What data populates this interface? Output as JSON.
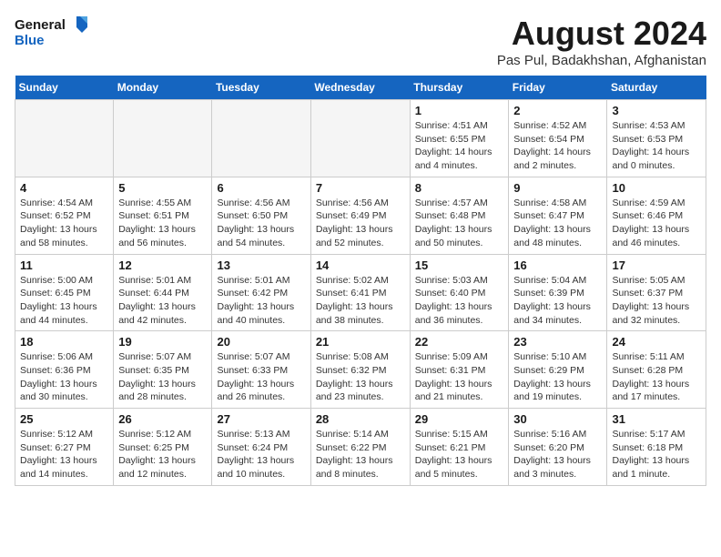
{
  "header": {
    "logo_line1": "General",
    "logo_line2": "Blue",
    "month_year": "August 2024",
    "location": "Pas Pul, Badakhshan, Afghanistan"
  },
  "days_of_week": [
    "Sunday",
    "Monday",
    "Tuesday",
    "Wednesday",
    "Thursday",
    "Friday",
    "Saturday"
  ],
  "weeks": [
    [
      {
        "day": "",
        "info": ""
      },
      {
        "day": "",
        "info": ""
      },
      {
        "day": "",
        "info": ""
      },
      {
        "day": "",
        "info": ""
      },
      {
        "day": "1",
        "info": "Sunrise: 4:51 AM\nSunset: 6:55 PM\nDaylight: 14 hours\nand 4 minutes."
      },
      {
        "day": "2",
        "info": "Sunrise: 4:52 AM\nSunset: 6:54 PM\nDaylight: 14 hours\nand 2 minutes."
      },
      {
        "day": "3",
        "info": "Sunrise: 4:53 AM\nSunset: 6:53 PM\nDaylight: 14 hours\nand 0 minutes."
      }
    ],
    [
      {
        "day": "4",
        "info": "Sunrise: 4:54 AM\nSunset: 6:52 PM\nDaylight: 13 hours\nand 58 minutes."
      },
      {
        "day": "5",
        "info": "Sunrise: 4:55 AM\nSunset: 6:51 PM\nDaylight: 13 hours\nand 56 minutes."
      },
      {
        "day": "6",
        "info": "Sunrise: 4:56 AM\nSunset: 6:50 PM\nDaylight: 13 hours\nand 54 minutes."
      },
      {
        "day": "7",
        "info": "Sunrise: 4:56 AM\nSunset: 6:49 PM\nDaylight: 13 hours\nand 52 minutes."
      },
      {
        "day": "8",
        "info": "Sunrise: 4:57 AM\nSunset: 6:48 PM\nDaylight: 13 hours\nand 50 minutes."
      },
      {
        "day": "9",
        "info": "Sunrise: 4:58 AM\nSunset: 6:47 PM\nDaylight: 13 hours\nand 48 minutes."
      },
      {
        "day": "10",
        "info": "Sunrise: 4:59 AM\nSunset: 6:46 PM\nDaylight: 13 hours\nand 46 minutes."
      }
    ],
    [
      {
        "day": "11",
        "info": "Sunrise: 5:00 AM\nSunset: 6:45 PM\nDaylight: 13 hours\nand 44 minutes."
      },
      {
        "day": "12",
        "info": "Sunrise: 5:01 AM\nSunset: 6:44 PM\nDaylight: 13 hours\nand 42 minutes."
      },
      {
        "day": "13",
        "info": "Sunrise: 5:01 AM\nSunset: 6:42 PM\nDaylight: 13 hours\nand 40 minutes."
      },
      {
        "day": "14",
        "info": "Sunrise: 5:02 AM\nSunset: 6:41 PM\nDaylight: 13 hours\nand 38 minutes."
      },
      {
        "day": "15",
        "info": "Sunrise: 5:03 AM\nSunset: 6:40 PM\nDaylight: 13 hours\nand 36 minutes."
      },
      {
        "day": "16",
        "info": "Sunrise: 5:04 AM\nSunset: 6:39 PM\nDaylight: 13 hours\nand 34 minutes."
      },
      {
        "day": "17",
        "info": "Sunrise: 5:05 AM\nSunset: 6:37 PM\nDaylight: 13 hours\nand 32 minutes."
      }
    ],
    [
      {
        "day": "18",
        "info": "Sunrise: 5:06 AM\nSunset: 6:36 PM\nDaylight: 13 hours\nand 30 minutes."
      },
      {
        "day": "19",
        "info": "Sunrise: 5:07 AM\nSunset: 6:35 PM\nDaylight: 13 hours\nand 28 minutes."
      },
      {
        "day": "20",
        "info": "Sunrise: 5:07 AM\nSunset: 6:33 PM\nDaylight: 13 hours\nand 26 minutes."
      },
      {
        "day": "21",
        "info": "Sunrise: 5:08 AM\nSunset: 6:32 PM\nDaylight: 13 hours\nand 23 minutes."
      },
      {
        "day": "22",
        "info": "Sunrise: 5:09 AM\nSunset: 6:31 PM\nDaylight: 13 hours\nand 21 minutes."
      },
      {
        "day": "23",
        "info": "Sunrise: 5:10 AM\nSunset: 6:29 PM\nDaylight: 13 hours\nand 19 minutes."
      },
      {
        "day": "24",
        "info": "Sunrise: 5:11 AM\nSunset: 6:28 PM\nDaylight: 13 hours\nand 17 minutes."
      }
    ],
    [
      {
        "day": "25",
        "info": "Sunrise: 5:12 AM\nSunset: 6:27 PM\nDaylight: 13 hours\nand 14 minutes."
      },
      {
        "day": "26",
        "info": "Sunrise: 5:12 AM\nSunset: 6:25 PM\nDaylight: 13 hours\nand 12 minutes."
      },
      {
        "day": "27",
        "info": "Sunrise: 5:13 AM\nSunset: 6:24 PM\nDaylight: 13 hours\nand 10 minutes."
      },
      {
        "day": "28",
        "info": "Sunrise: 5:14 AM\nSunset: 6:22 PM\nDaylight: 13 hours\nand 8 minutes."
      },
      {
        "day": "29",
        "info": "Sunrise: 5:15 AM\nSunset: 6:21 PM\nDaylight: 13 hours\nand 5 minutes."
      },
      {
        "day": "30",
        "info": "Sunrise: 5:16 AM\nSunset: 6:20 PM\nDaylight: 13 hours\nand 3 minutes."
      },
      {
        "day": "31",
        "info": "Sunrise: 5:17 AM\nSunset: 6:18 PM\nDaylight: 13 hours\nand 1 minute."
      }
    ]
  ]
}
